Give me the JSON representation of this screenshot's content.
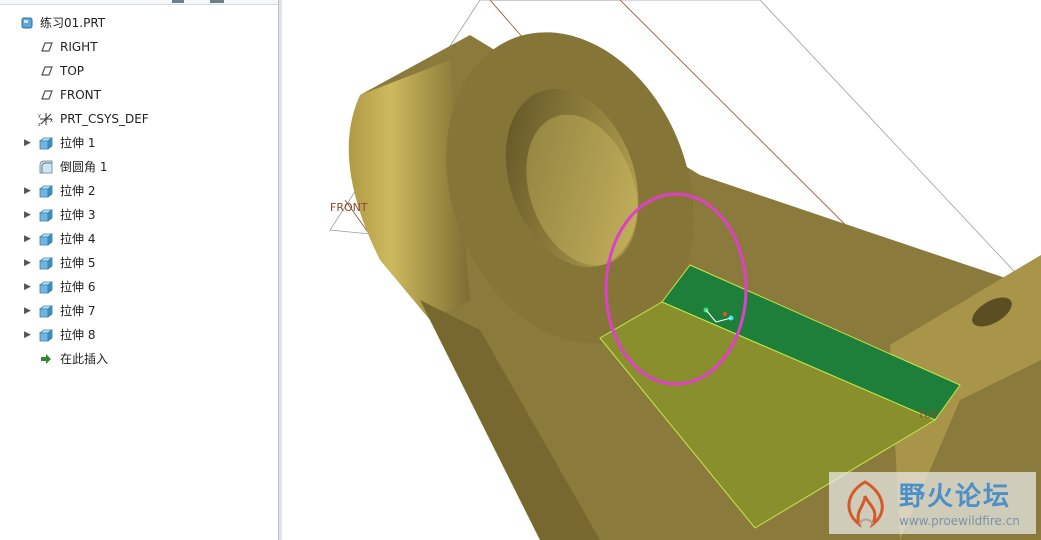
{
  "model_tree": {
    "root": "练习01.PRT",
    "items": [
      {
        "label": "RIGHT",
        "icon": "datum-plane-icon",
        "expandable": false
      },
      {
        "label": "TOP",
        "icon": "datum-plane-icon",
        "expandable": false
      },
      {
        "label": "FRONT",
        "icon": "datum-plane-icon",
        "expandable": false
      },
      {
        "label": "PRT_CSYS_DEF",
        "icon": "csys-icon",
        "expandable": false
      },
      {
        "label": "拉伸 1",
        "icon": "extrude-icon",
        "expandable": true
      },
      {
        "label": "倒圆角 1",
        "icon": "round-icon",
        "expandable": false
      },
      {
        "label": "拉伸 2",
        "icon": "extrude-icon",
        "expandable": true
      },
      {
        "label": "拉伸 3",
        "icon": "extrude-icon",
        "expandable": true
      },
      {
        "label": "拉伸 4",
        "icon": "extrude-icon",
        "expandable": true
      },
      {
        "label": "拉伸 5",
        "icon": "extrude-icon",
        "expandable": true
      },
      {
        "label": "拉伸 6",
        "icon": "extrude-icon",
        "expandable": true
      },
      {
        "label": "拉伸 7",
        "icon": "extrude-icon",
        "expandable": true
      },
      {
        "label": "拉伸 8",
        "icon": "extrude-icon",
        "expandable": true
      }
    ],
    "insert_here": "在此插入"
  },
  "viewport": {
    "plane_labels": {
      "front": "FRONT",
      "top": "TOP"
    },
    "colors": {
      "model": "#8a7a3c",
      "model_light": "#c2ae58",
      "selected_face": "#1e7f3a",
      "highlight_face": "#8a8f2e",
      "annotation_circle": "#e040c8",
      "datum_line": "#8a4a2a"
    }
  },
  "watermark": {
    "title": "野火论坛",
    "url": "www.proewildfire.cn"
  }
}
